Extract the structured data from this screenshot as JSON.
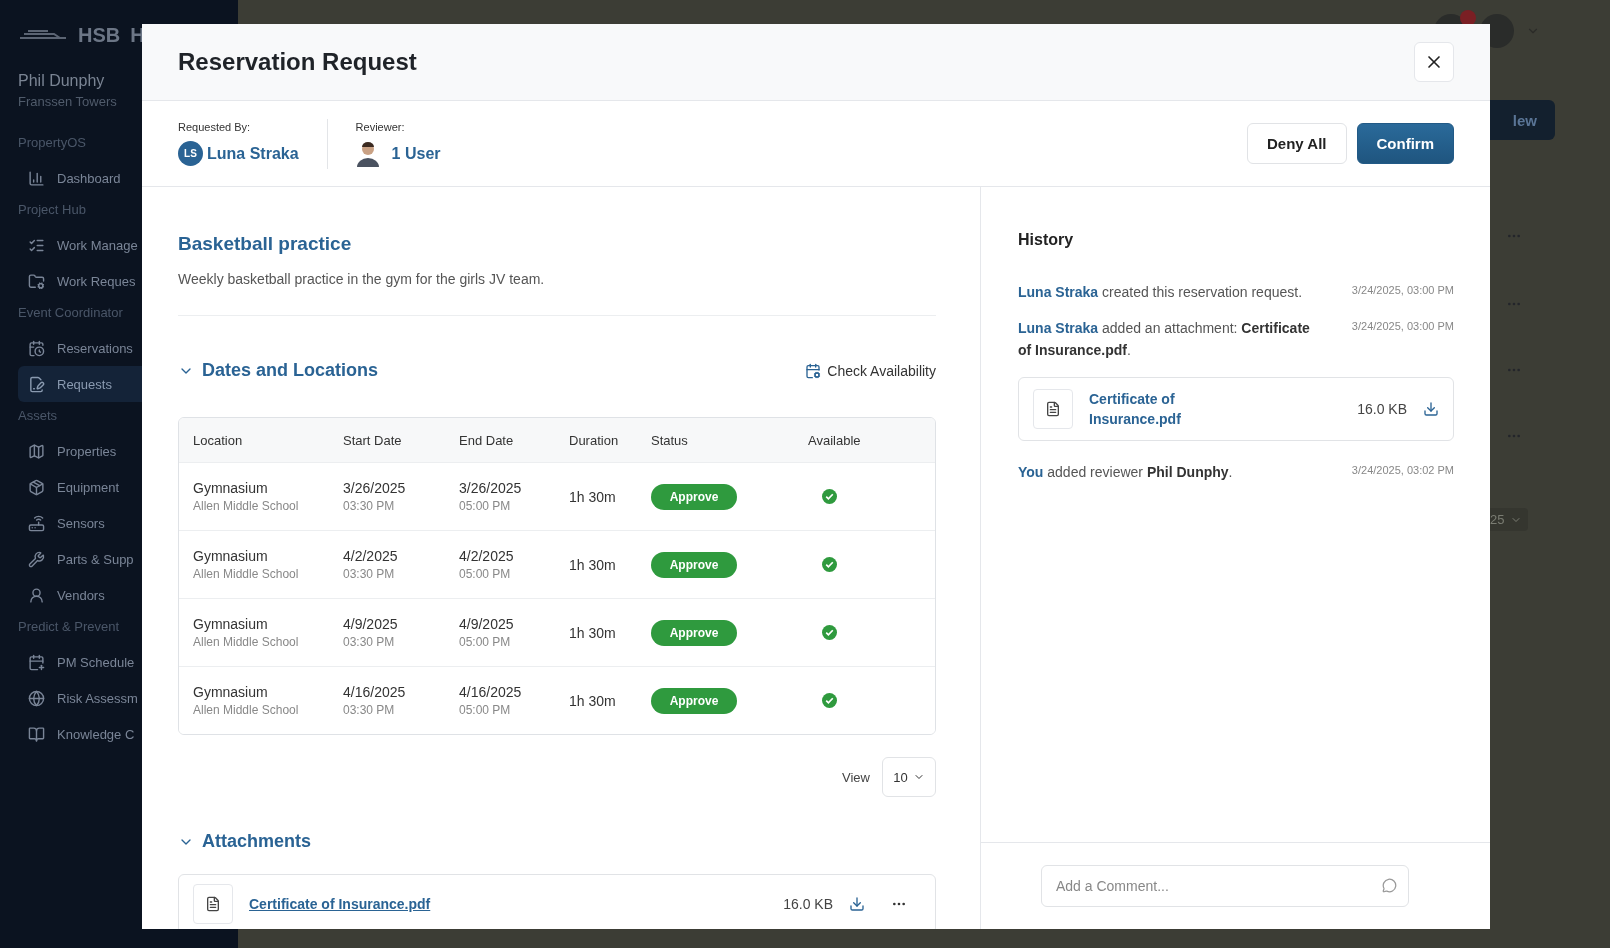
{
  "sidebar": {
    "logo": "HSB",
    "logo_second": "H",
    "user": "Phil Dunphy",
    "property": "Franssen Towers",
    "sections": [
      {
        "title": "PropertyOS",
        "items": [
          {
            "label": "Dashboard",
            "selected": false
          }
        ]
      },
      {
        "title": "Project Hub",
        "items": [
          {
            "label": "Work Manage",
            "selected": false
          },
          {
            "label": "Work Reques",
            "selected": false
          }
        ]
      },
      {
        "title": "Event Coordinator",
        "items": [
          {
            "label": "Reservations",
            "selected": false
          },
          {
            "label": "Requests",
            "selected": true
          }
        ]
      },
      {
        "title": "Assets",
        "items": [
          {
            "label": "Properties",
            "selected": false
          },
          {
            "label": "Equipment",
            "selected": false
          },
          {
            "label": "Sensors",
            "selected": false
          },
          {
            "label": "Parts & Supp",
            "selected": false
          },
          {
            "label": "Vendors",
            "selected": false
          }
        ]
      },
      {
        "title": "Predict & Prevent",
        "items": [
          {
            "label": "PM Schedule",
            "selected": false
          },
          {
            "label": "Risk Assessm",
            "selected": false
          },
          {
            "label": "Knowledge C",
            "selected": false
          }
        ]
      }
    ]
  },
  "background": {
    "new_button": "lew",
    "page_size": "25"
  },
  "modal": {
    "title": "Reservation Request",
    "requested_by_label": "Requested By:",
    "requester": {
      "initials": "LS",
      "name": "Luna Straka"
    },
    "reviewer_label": "Reviewer:",
    "reviewer_value": "1 User",
    "buttons": [
      {
        "label": "Deny All",
        "kind": "secondary"
      },
      {
        "label": "Confirm",
        "kind": "primary"
      }
    ],
    "event_title": "Basketball practice",
    "description": "Weekly basketball practice in the gym for the girls JV team.",
    "dates_section": {
      "title": "Dates and Locations",
      "expanded": true,
      "action": "Check Availability"
    },
    "table": {
      "columns": [
        "Location",
        "Start Date",
        "End Date",
        "Duration",
        "Status",
        "Available"
      ],
      "rows": [
        {
          "location": "Gymnasium",
          "school": "Allen Middle School",
          "start_date": "3/26/2025",
          "start_time": "03:30 PM",
          "end_date": "3/26/2025",
          "end_time": "05:00 PM",
          "duration": "1h 30m",
          "status": "Approve",
          "available": true
        },
        {
          "location": "Gymnasium",
          "school": "Allen Middle School",
          "start_date": "4/2/2025",
          "start_time": "03:30 PM",
          "end_date": "4/2/2025",
          "end_time": "05:00 PM",
          "duration": "1h 30m",
          "status": "Approve",
          "available": true
        },
        {
          "location": "Gymnasium",
          "school": "Allen Middle School",
          "start_date": "4/9/2025",
          "start_time": "03:30 PM",
          "end_date": "4/9/2025",
          "end_time": "05:00 PM",
          "duration": "1h 30m",
          "status": "Approve",
          "available": true
        },
        {
          "location": "Gymnasium",
          "school": "Allen Middle School",
          "start_date": "4/16/2025",
          "start_time": "03:30 PM",
          "end_date": "4/16/2025",
          "end_time": "05:00 PM",
          "duration": "1h 30m",
          "status": "Approve",
          "available": true
        }
      ]
    },
    "view_label": "View",
    "page_size": "10",
    "attachments_section": {
      "title": "Attachments",
      "expanded": true,
      "items": [
        {
          "name": "Certificate of Insurance.pdf",
          "size": "16.0 KB"
        }
      ]
    },
    "history": {
      "title": "History",
      "entries": [
        {
          "text": "**Luna Straka** created this reservation request.",
          "time": "3/24/2025, 03:00 PM"
        },
        {
          "text": "**Luna Straka** added an attachment: **Certificate of Insurance.pdf**.",
          "time": "3/24/2025, 03:00 PM",
          "attachment": {
            "name": "Certificate of Insurance.pdf",
            "size": "16.0 KB"
          }
        },
        {
          "text": "**You** added reviewer **Phil Dunphy**.",
          "time": "3/24/2025, 03:02 PM"
        }
      ]
    },
    "comment_placeholder": "Add a Comment..."
  }
}
